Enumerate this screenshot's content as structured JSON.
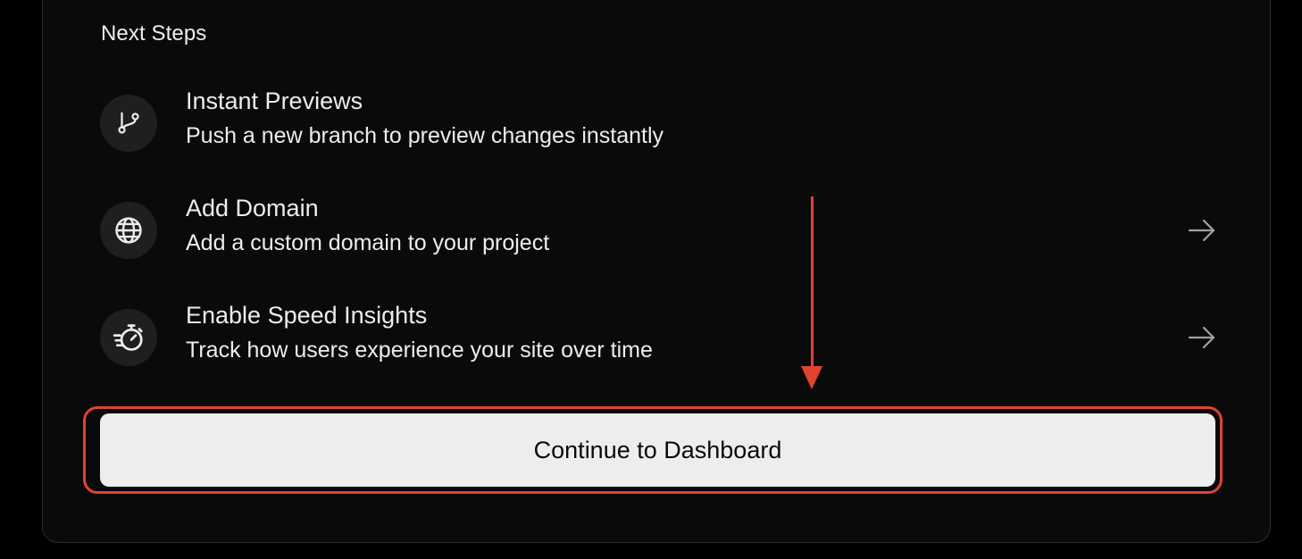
{
  "section": {
    "title": "Next Steps"
  },
  "steps": [
    {
      "icon": "git-branch-icon",
      "title": "Instant Previews",
      "description": "Push a new branch to preview changes instantly",
      "has_arrow": false
    },
    {
      "icon": "globe-icon",
      "title": "Add Domain",
      "description": "Add a custom domain to your project",
      "has_arrow": true
    },
    {
      "icon": "stopwatch-icon",
      "title": "Enable Speed Insights",
      "description": "Track how users experience your site over time",
      "has_arrow": true
    }
  ],
  "cta": {
    "label": "Continue to Dashboard"
  },
  "colors": {
    "background": "#000000",
    "card": "#0a0a0a",
    "icon_bg": "#1f1f1f",
    "text": "#ededed",
    "button_bg": "#ededed",
    "button_text": "#0a0a0a",
    "annotation": "#e2432f"
  }
}
